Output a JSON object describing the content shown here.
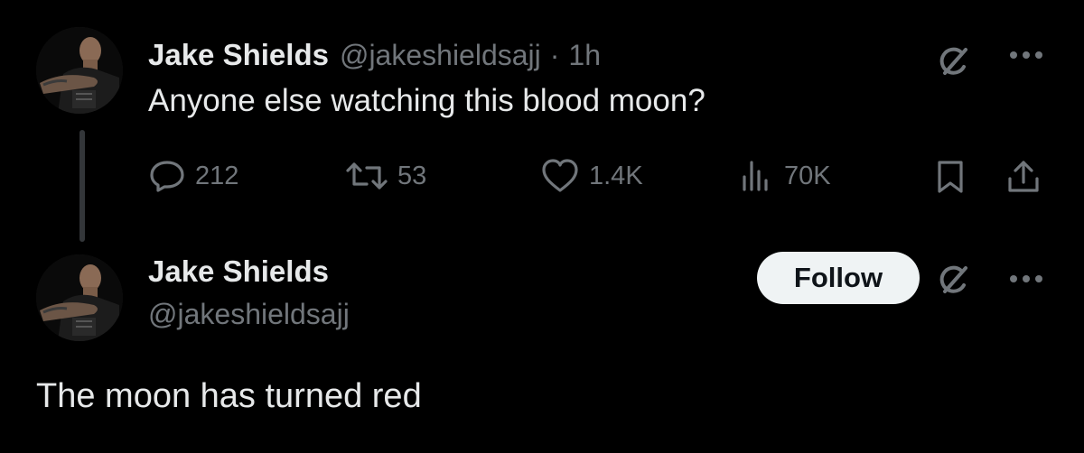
{
  "reply_tweet": {
    "author": {
      "display_name": "Jake Shields",
      "handle": "@jakeshieldsajj"
    },
    "separator": "·",
    "time": "1h",
    "text": "Anyone else watching this blood moon?",
    "metrics": {
      "replies": "212",
      "reposts": "53",
      "likes": "1.4K",
      "views": "70K"
    }
  },
  "main_tweet": {
    "author": {
      "display_name": "Jake Shields",
      "handle": "@jakeshieldsajj"
    },
    "follow_label": "Follow",
    "text": "The moon has turned red"
  },
  "icons": {
    "grok": "grok-icon",
    "more": "more-icon",
    "reply": "reply-icon",
    "repost": "repost-icon",
    "like": "like-icon",
    "views": "views-icon",
    "bookmark": "bookmark-icon",
    "share": "share-icon"
  },
  "colors": {
    "background": "#000000",
    "primary_text": "#e7e9ea",
    "secondary_text": "#71767b",
    "follow_bg": "#eff3f4",
    "follow_text": "#0f1419",
    "thread_line": "#333639"
  }
}
